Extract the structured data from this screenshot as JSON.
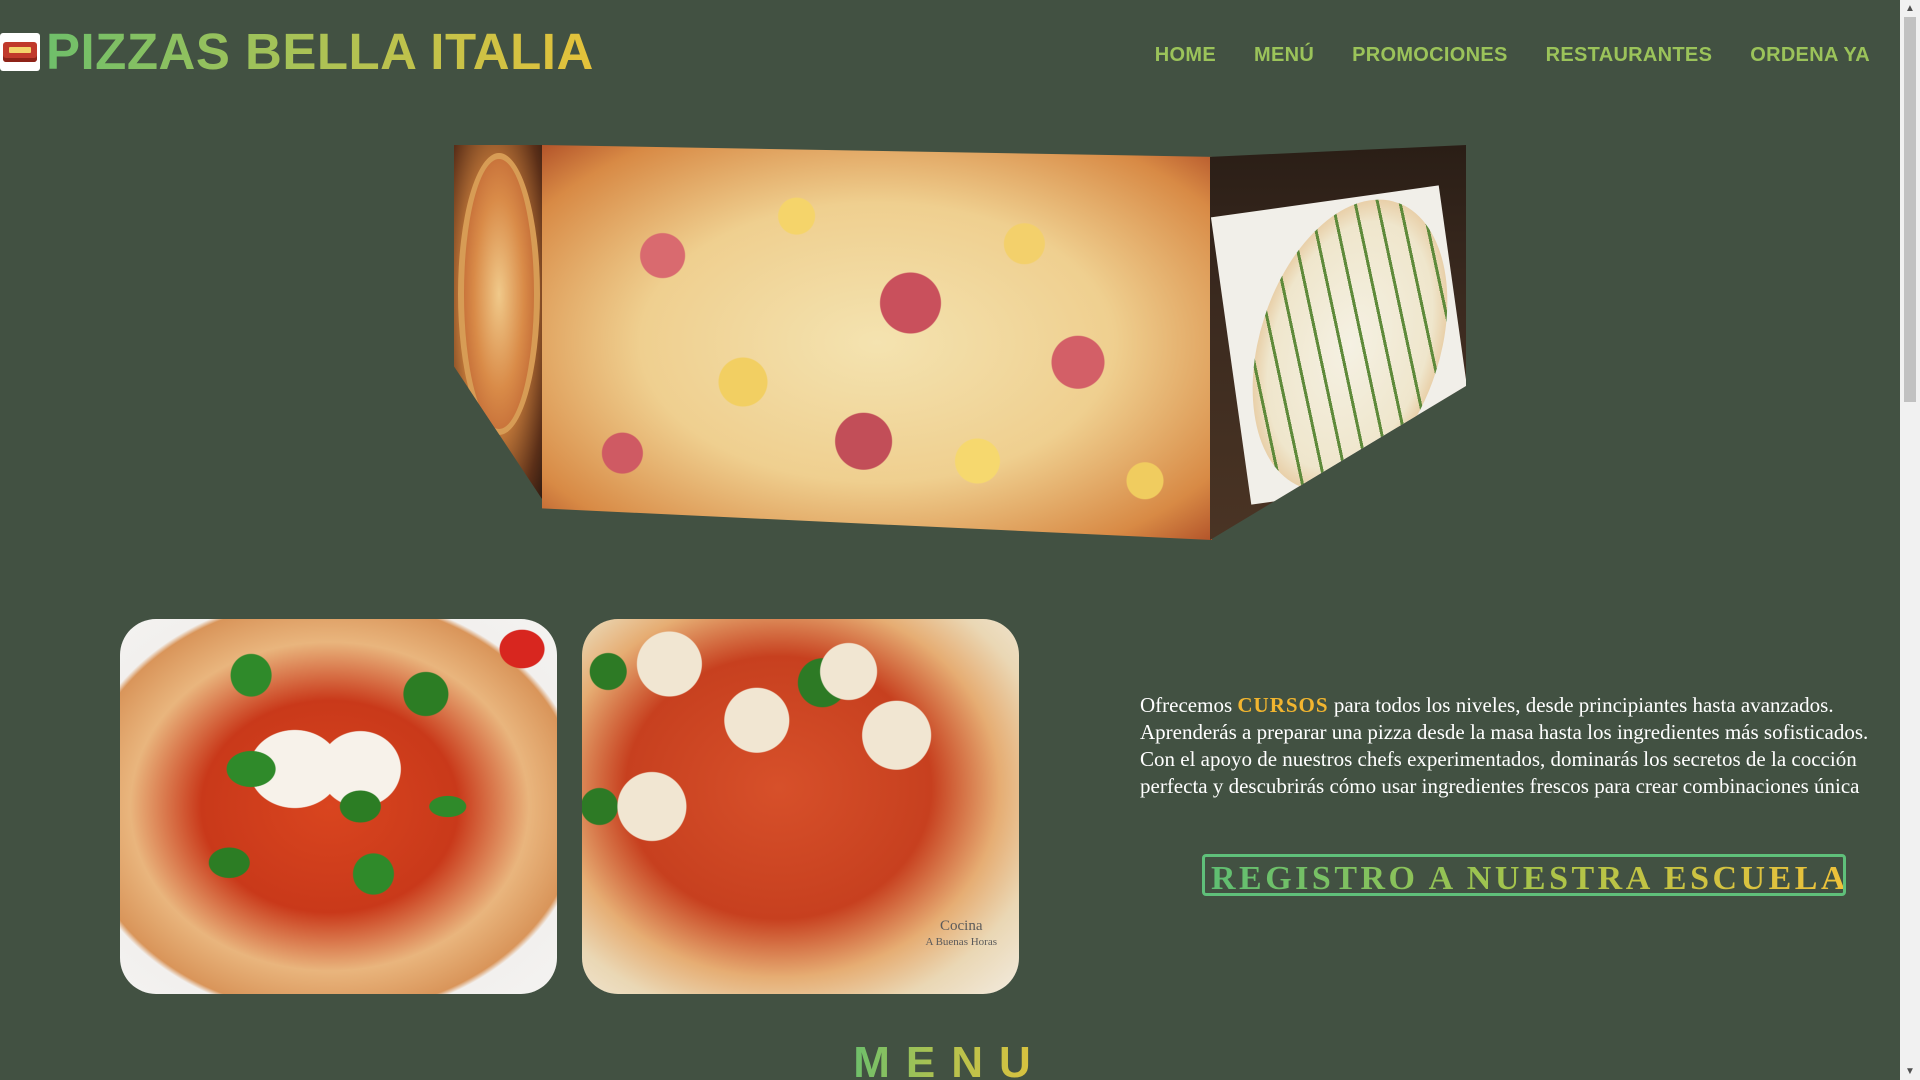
{
  "header": {
    "brand": "PIZZAS BELLA ITALIA",
    "logo_icon": "pizza-box-icon",
    "nav": [
      {
        "label": "HOME"
      },
      {
        "label": "MENÚ"
      },
      {
        "label": "PROMOCIONES"
      },
      {
        "label": "RESTAURANTES"
      },
      {
        "label": "ORDENA YA"
      }
    ]
  },
  "hero": {
    "images": [
      "pizza-left-image",
      "pizza-hawaiana-image",
      "pizza-verde-image"
    ]
  },
  "intro": {
    "before": "Ofrecemos ",
    "highlight": "CURSOS",
    "after": " para todos los niveles, desde principiantes hasta avanzados. Aprenderás a preparar una pizza desde la masa hasta los ingredientes más sofisticados. Con el apoyo de nuestros chefs experimentados, dominarás los secretos de la cocción perfecta y descubrirás cómo usar ingredientes frescos para crear combinaciones única"
  },
  "cta": {
    "label": "REGISTRO A NUESTRA ESCUELA"
  },
  "gallery": {
    "watermark_line1": "Cocina",
    "watermark_line2": "A Buenas Horas"
  },
  "menu_heading": "MENU",
  "colors": {
    "background": "#425142",
    "nav": "#9bc35a",
    "highlight": "#f2b52f",
    "cta_border": "#5fc07a"
  }
}
